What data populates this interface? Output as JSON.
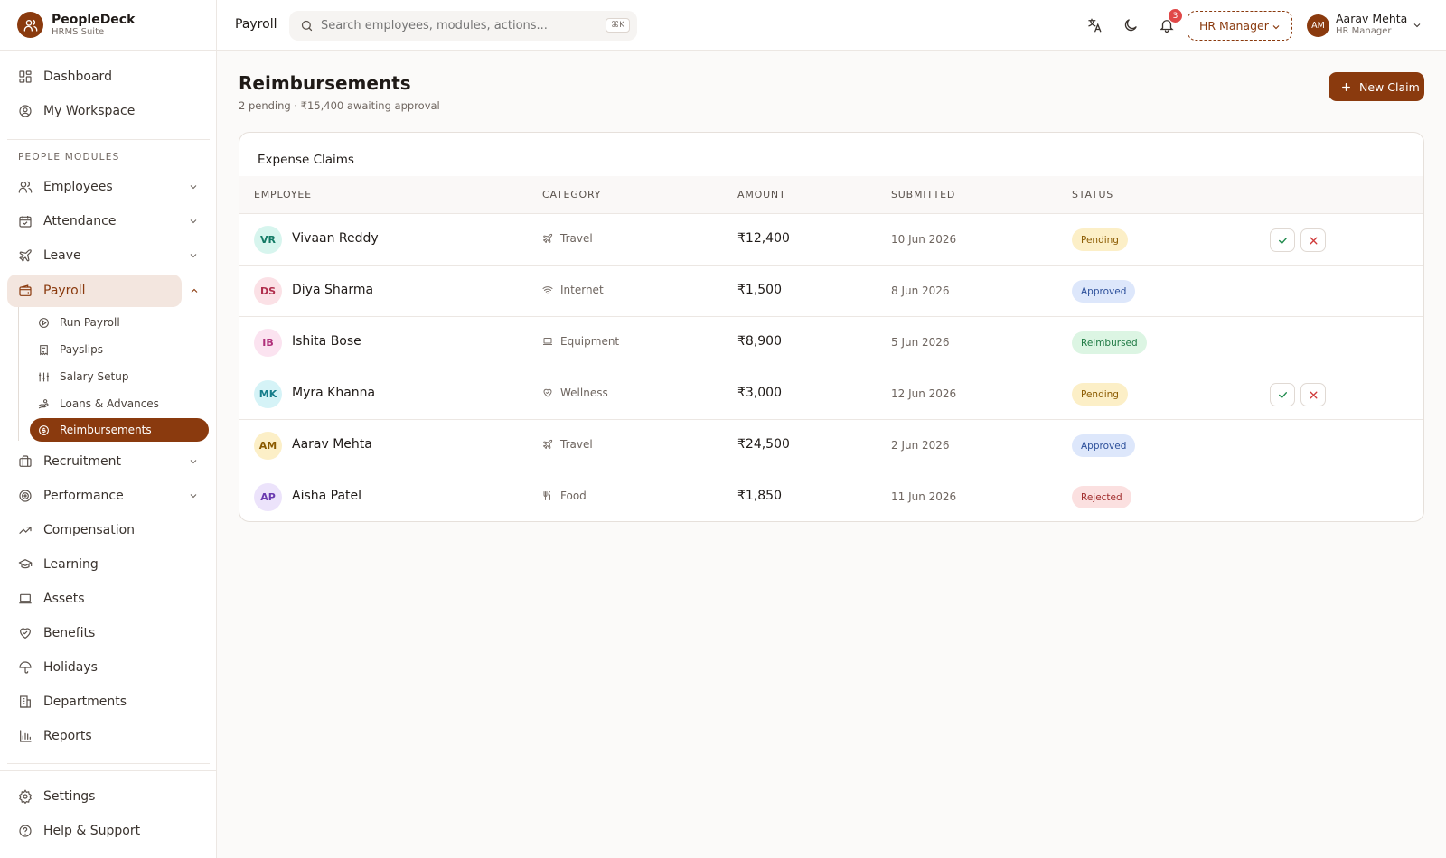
{
  "brand": {
    "name": "PeopleDeck",
    "subtitle": "HRMS Suite"
  },
  "sidebar": {
    "top_items": [
      {
        "label": "Dashboard",
        "icon": "dashboard-icon"
      },
      {
        "label": "My Workspace",
        "icon": "user-circle-icon"
      }
    ],
    "section_label": "PEOPLE MODULES",
    "modules": [
      {
        "label": "Employees",
        "icon": "users-icon",
        "expandable": true
      },
      {
        "label": "Attendance",
        "icon": "calendar-check-icon",
        "expandable": true
      },
      {
        "label": "Leave",
        "icon": "plane-icon",
        "expandable": true
      },
      {
        "label": "Payroll",
        "icon": "wallet-icon",
        "expandable": true,
        "active": true
      },
      {
        "label": "Recruitment",
        "icon": "briefcase-icon",
        "expandable": true
      },
      {
        "label": "Performance",
        "icon": "target-icon",
        "expandable": true
      },
      {
        "label": "Compensation",
        "icon": "trending-up-icon"
      },
      {
        "label": "Learning",
        "icon": "graduation-cap-icon"
      },
      {
        "label": "Assets",
        "icon": "laptop-icon"
      },
      {
        "label": "Benefits",
        "icon": "heart-handshake-icon"
      },
      {
        "label": "Holidays",
        "icon": "umbrella-icon"
      },
      {
        "label": "Departments",
        "icon": "building-icon"
      },
      {
        "label": "Reports",
        "icon": "bar-chart-icon"
      }
    ],
    "payroll_sub": [
      {
        "label": "Run Payroll",
        "icon": "play-circle-icon"
      },
      {
        "label": "Payslips",
        "icon": "receipt-icon"
      },
      {
        "label": "Salary Setup",
        "icon": "sliders-icon"
      },
      {
        "label": "Loans & Advances",
        "icon": "hand-coins-icon"
      },
      {
        "label": "Reimbursements",
        "icon": "badge-dollar-icon",
        "active": true
      }
    ],
    "bottom_items": [
      {
        "label": "Settings",
        "icon": "gear-icon"
      },
      {
        "label": "Help & Support",
        "icon": "help-circle-icon"
      }
    ]
  },
  "topbar": {
    "breadcrumb": "Payroll",
    "search_placeholder": "Search employees, modules, actions...",
    "shortcut": "⌘K",
    "notification_count": "3",
    "role": "HR Manager",
    "user": {
      "initials": "AM",
      "name": "Aarav Mehta",
      "role": "HR Manager"
    }
  },
  "main": {
    "title": "Reimbursements",
    "subtitle": "2 pending · ₹15,400 awaiting approval",
    "new_claim_label": "New Claim",
    "card_title": "Expense Claims",
    "columns": [
      "EMPLOYEE",
      "CATEGORY",
      "AMOUNT",
      "SUBMITTED",
      "STATUS"
    ],
    "rows": [
      {
        "initials": "VR",
        "name": "Vivaan Reddy",
        "category": "Travel",
        "category_icon": "plane-icon",
        "amount": "₹12,400",
        "date": "10 Jun 2026",
        "status": "Pending",
        "avatar_bg": "#d7f5ee",
        "avatar_fg": "#137a65"
      },
      {
        "initials": "DS",
        "name": "Diya Sharma",
        "category": "Internet",
        "category_icon": "wifi-icon",
        "amount": "₹1,500",
        "date": "8 Jun 2026",
        "status": "Approved",
        "avatar_bg": "#fbe1e6",
        "avatar_fg": "#b02e4c"
      },
      {
        "initials": "IB",
        "name": "Ishita Bose",
        "category": "Equipment",
        "category_icon": "laptop-icon",
        "amount": "₹8,900",
        "date": "5 Jun 2026",
        "status": "Reimbursed",
        "avatar_bg": "#fbe3f0",
        "avatar_fg": "#b0307a"
      },
      {
        "initials": "MK",
        "name": "Myra Khanna",
        "category": "Wellness",
        "category_icon": "heart-handshake-icon",
        "amount": "₹3,000",
        "date": "12 Jun 2026",
        "status": "Pending",
        "avatar_bg": "#d5f3f7",
        "avatar_fg": "#177d8a"
      },
      {
        "initials": "AM",
        "name": "Aarav Mehta",
        "category": "Travel",
        "category_icon": "plane-icon",
        "amount": "₹24,500",
        "date": "2 Jun 2026",
        "status": "Approved",
        "avatar_bg": "#fcefc7",
        "avatar_fg": "#8a5a00"
      },
      {
        "initials": "AP",
        "name": "Aisha Patel",
        "category": "Food",
        "category_icon": "utensils-icon",
        "amount": "₹1,850",
        "date": "11 Jun 2026",
        "status": "Rejected",
        "avatar_bg": "#ece3fb",
        "avatar_fg": "#6a3ab0"
      }
    ]
  },
  "colors": {
    "accent": "#8a3a0e",
    "approve": "#1f8a4c",
    "reject": "#d03a3a"
  }
}
